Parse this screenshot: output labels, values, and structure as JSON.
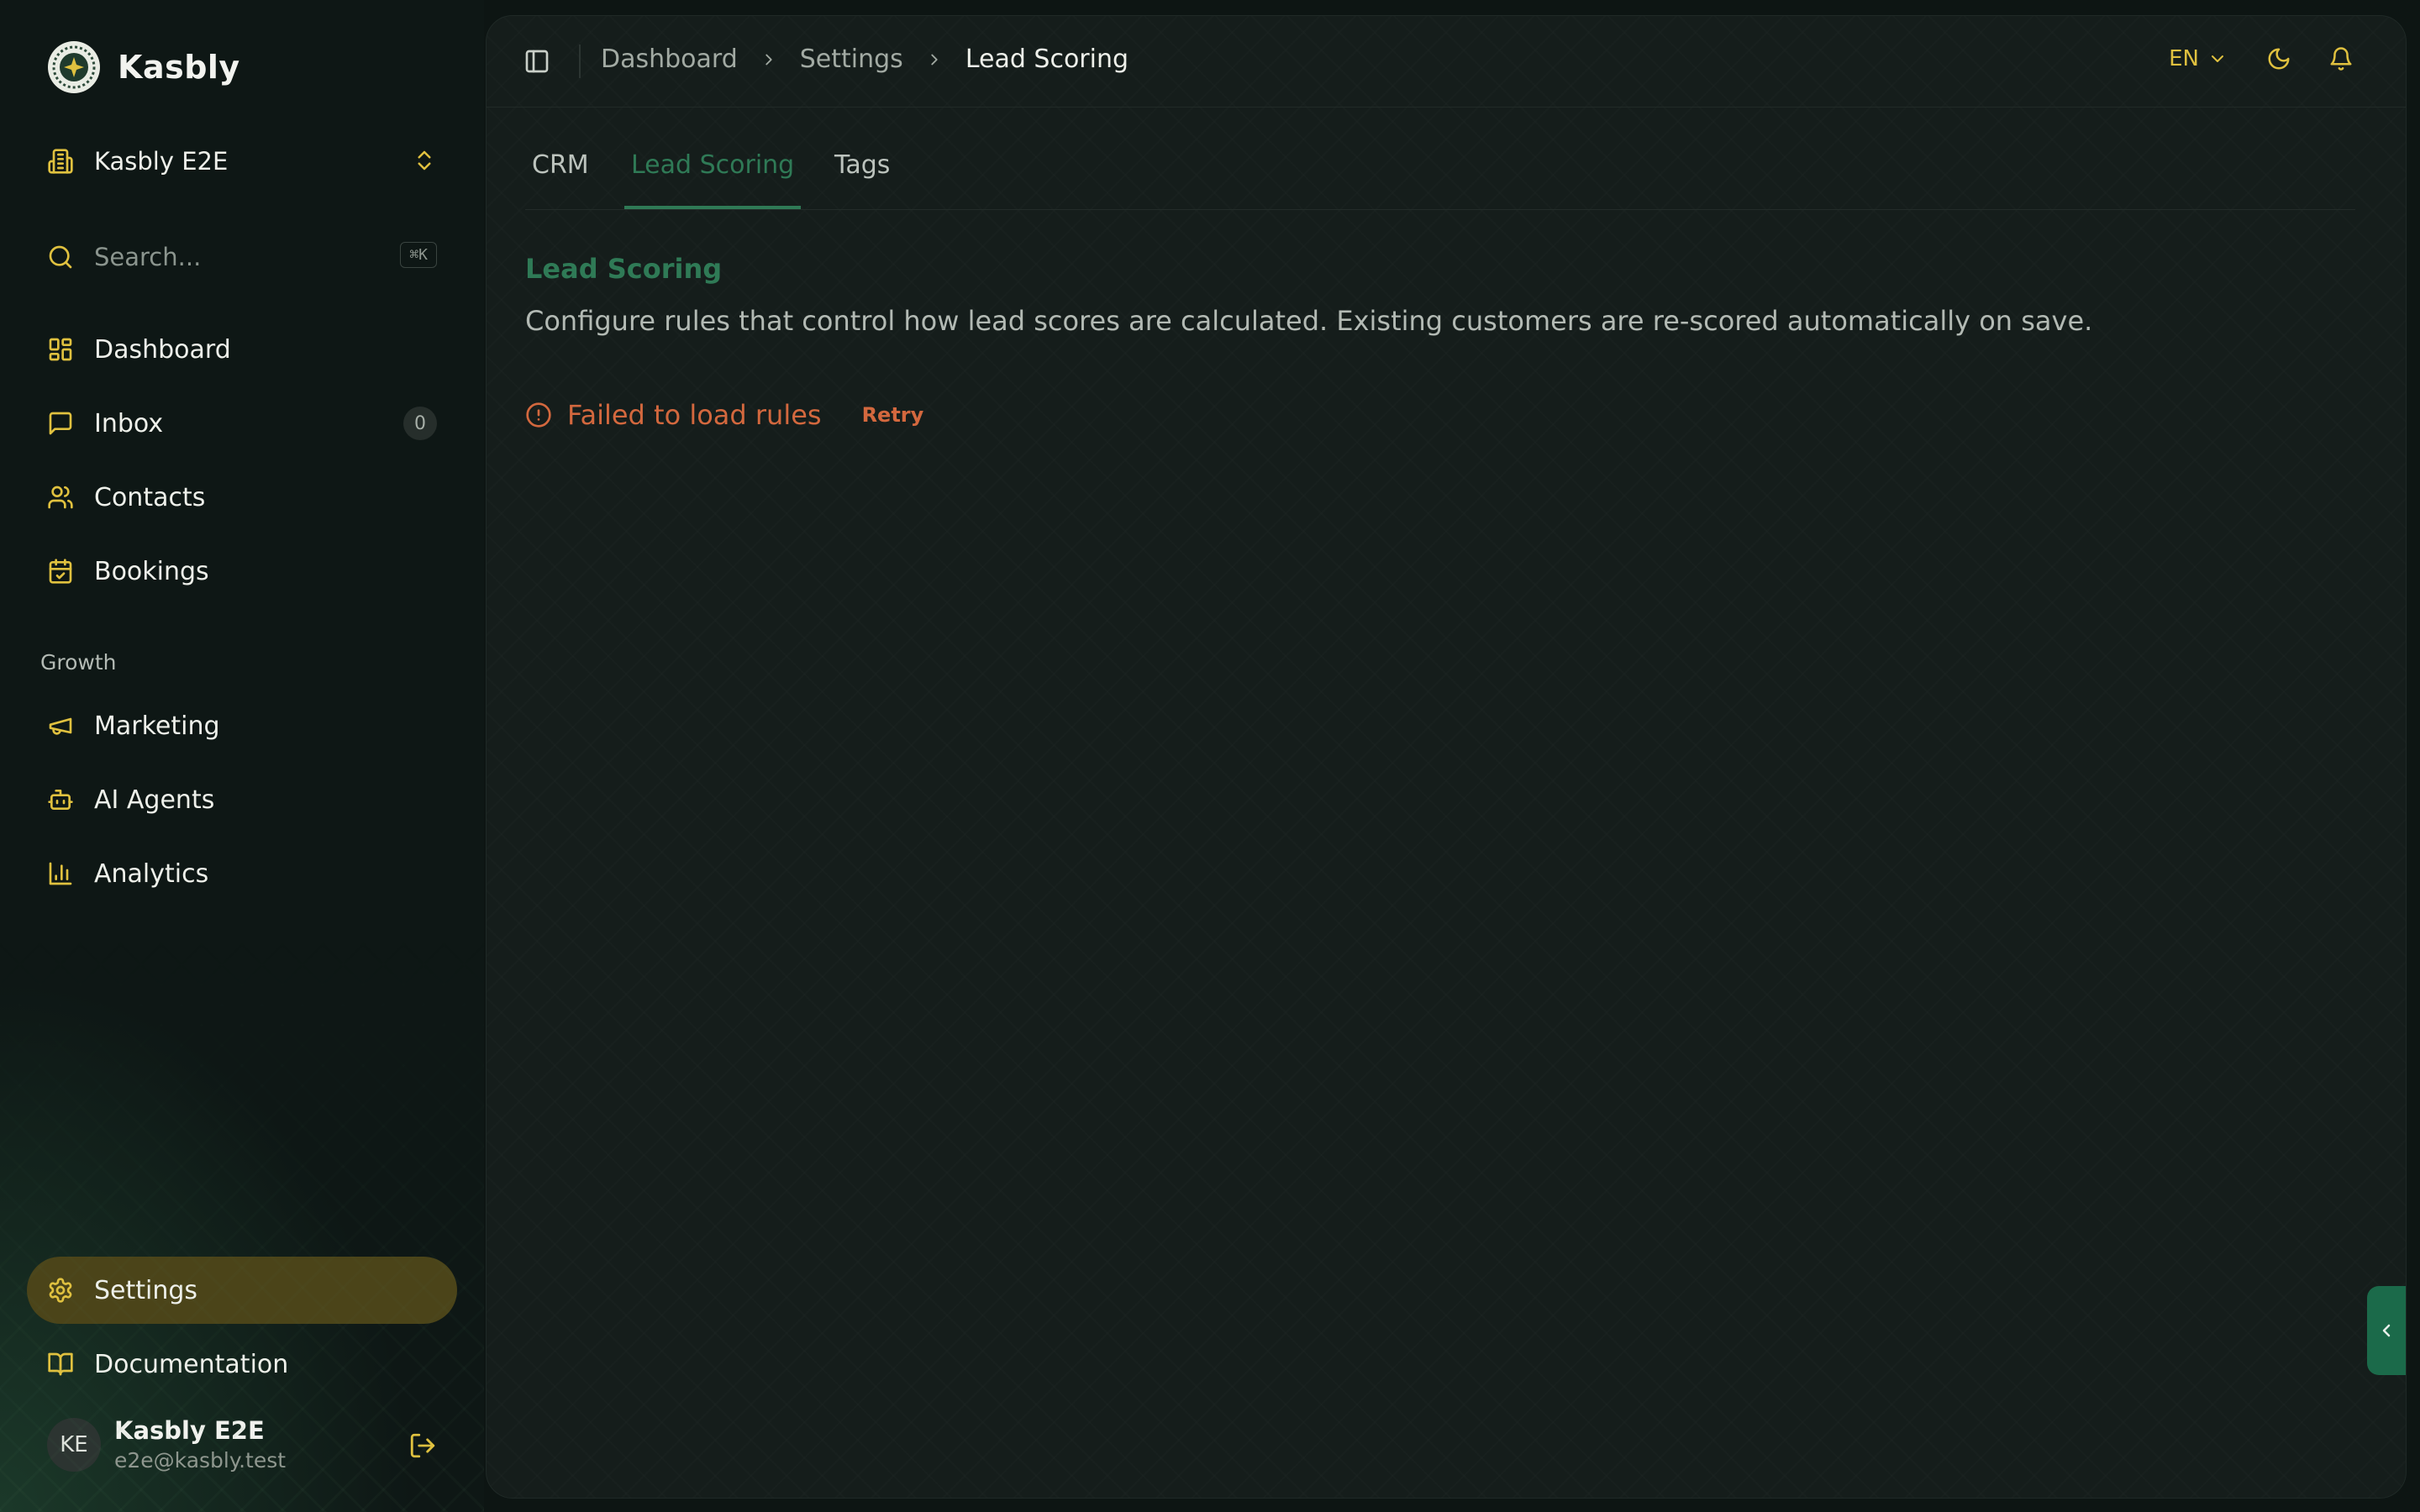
{
  "app": {
    "name": "Kasbly"
  },
  "org": {
    "name": "Kasbly E2E"
  },
  "search": {
    "placeholder": "Search...",
    "shortcut": "⌘K"
  },
  "nav": {
    "dashboard": "Dashboard",
    "inbox": "Inbox",
    "inbox_count": "0",
    "contacts": "Contacts",
    "bookings": "Bookings",
    "growth_label": "Growth",
    "marketing": "Marketing",
    "ai_agents": "AI Agents",
    "analytics": "Analytics",
    "settings": "Settings",
    "documentation": "Documentation"
  },
  "user": {
    "initials": "KE",
    "name": "Kasbly E2E",
    "email": "e2e@kasbly.test"
  },
  "breadcrumb": [
    "Dashboard",
    "Settings",
    "Lead Scoring"
  ],
  "header": {
    "language": "EN"
  },
  "tabs": [
    "CRM",
    "Lead Scoring",
    "Tags"
  ],
  "active_tab": "Lead Scoring",
  "section": {
    "title": "Lead Scoring",
    "description": "Configure rules that control how lead scores are calculated. Existing customers are re-scored automatically on save."
  },
  "error": {
    "message": "Failed to load rules",
    "retry": "Retry"
  },
  "colors": {
    "accent_gold": "#e0c13f",
    "accent_green": "#2f7a56",
    "error_orange": "#d3683e",
    "active_nav_bg": "#4b4419"
  }
}
